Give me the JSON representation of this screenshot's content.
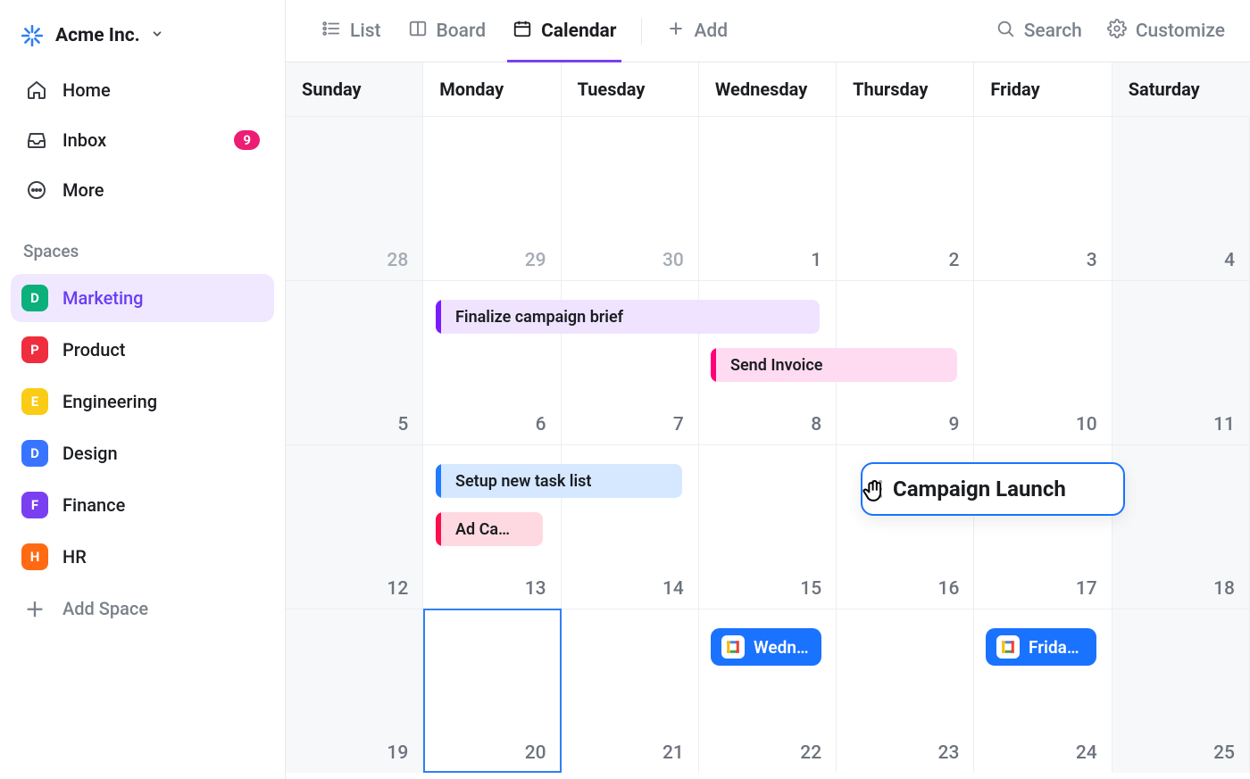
{
  "workspace": {
    "name": "Acme Inc."
  },
  "nav": {
    "home": "Home",
    "inbox": "Inbox",
    "inbox_badge": "9",
    "more": "More"
  },
  "sidebar": {
    "section_label": "Spaces",
    "spaces": [
      {
        "letter": "D",
        "label": "Marketing",
        "color": "#0bb07b",
        "active": true
      },
      {
        "letter": "P",
        "label": "Product",
        "color": "#ef2d3f",
        "active": false
      },
      {
        "letter": "E",
        "label": "Engineering",
        "color": "#facc15",
        "active": false
      },
      {
        "letter": "D",
        "label": "Design",
        "color": "#3874ff",
        "active": false
      },
      {
        "letter": "F",
        "label": "Finance",
        "color": "#7b3ff2",
        "active": false
      },
      {
        "letter": "H",
        "label": "HR",
        "color": "#ff6a13",
        "active": false
      }
    ],
    "add_space": "Add Space"
  },
  "topbar": {
    "views": [
      {
        "id": "list",
        "label": "List",
        "active": false
      },
      {
        "id": "board",
        "label": "Board",
        "active": false
      },
      {
        "id": "calendar",
        "label": "Calendar",
        "active": true
      }
    ],
    "add": "Add",
    "search": "Search",
    "customize": "Customize"
  },
  "calendar": {
    "day_names": [
      "Sunday",
      "Monday",
      "Tuesday",
      "Wednesday",
      "Thursday",
      "Friday",
      "Saturday"
    ],
    "weeks": [
      [
        "28",
        "29",
        "30",
        "1",
        "2",
        "3",
        "4"
      ],
      [
        "5",
        "6",
        "7",
        "8",
        "9",
        "10",
        "11"
      ],
      [
        "12",
        "13",
        "14",
        "15",
        "16",
        "17",
        "18"
      ],
      [
        "19",
        "20",
        "21",
        "22",
        "23",
        "24",
        "25"
      ]
    ],
    "muted_dates": [
      "28",
      "29",
      "30"
    ],
    "today": "20",
    "events": {
      "finalize_brief": "Finalize campaign brief",
      "send_invoice": "Send Invoice",
      "setup_task": "Setup new task list",
      "ad_campaign": "Ad Ca…",
      "campaign_launch": "Campaign Launch",
      "wed_chip": "Wedn…",
      "fri_chip": "Frida…"
    }
  }
}
